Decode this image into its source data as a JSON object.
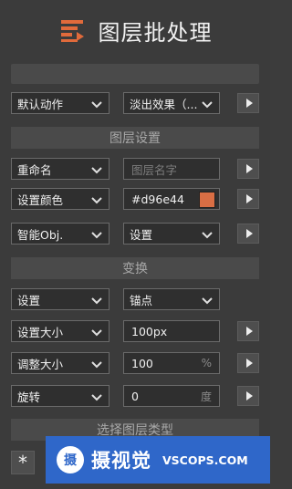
{
  "header": {
    "title": "图层批处理"
  },
  "actions": {
    "action_select": "默认动作",
    "effect_select": "淡出效果（..."
  },
  "layer_settings": {
    "section_label": "图层设置",
    "rename_select": "重命名",
    "name_placeholder": "图层名字",
    "color_select": "设置颜色",
    "color_value": "#d96e44",
    "smartobj_select": "智能Obj.",
    "smartobj_option": "设置"
  },
  "transform": {
    "section_label": "变换",
    "set_select": "设置",
    "anchor_select": "锚点",
    "size_select": "设置大小",
    "size_value": "100px",
    "scale_select": "调整大小",
    "scale_value": "100",
    "scale_unit": "%",
    "rotate_select": "旋转",
    "rotate_value": "0",
    "rotate_unit": "度"
  },
  "layer_type": {
    "section_label": "选择图层类型",
    "star_label": "*"
  },
  "watermark": {
    "logo_char": "摄",
    "text": "摄视觉",
    "domain": "VSCOPS.COM"
  },
  "colors": {
    "accent": "#d96e44",
    "banner": "#2f67c9"
  }
}
